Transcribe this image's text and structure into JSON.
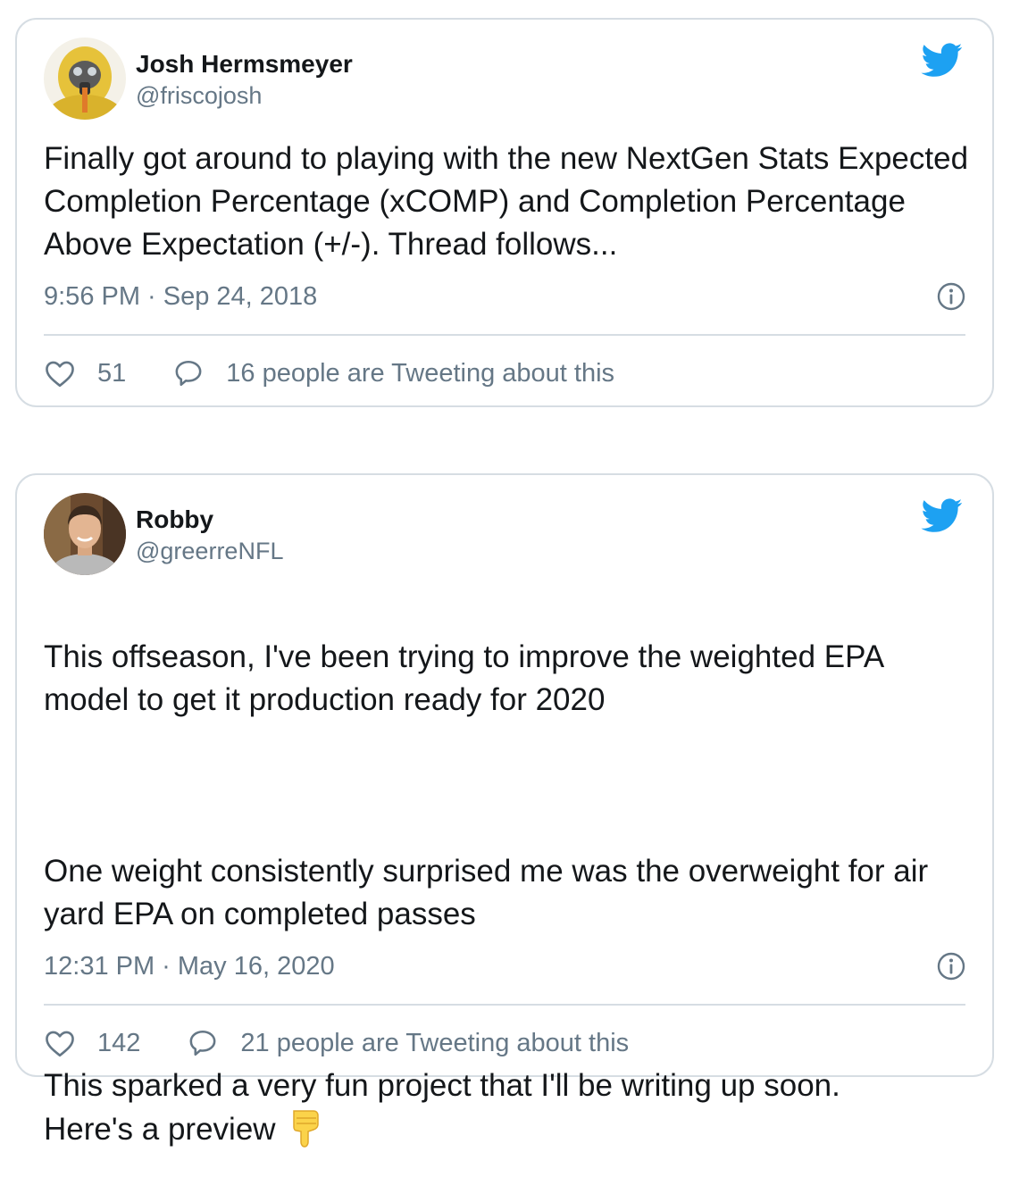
{
  "tweets": [
    {
      "author_name": "Josh Hermsmeyer",
      "author_handle": "@friscojosh",
      "avatar_icon": "hazmat-avatar",
      "text": "Finally got around to playing with the new NextGen Stats Expected Completion Percentage (xCOMP) and Completion Percentage Above Expectation (+/-). Thread follows...",
      "timestamp": "9:56 PM · Sep 24, 2018",
      "likes": "51",
      "tweeting_text": "16 people are Tweeting about this"
    },
    {
      "author_name": "Robby",
      "author_handle": "@greerreNFL",
      "avatar_icon": "profile-photo-avatar",
      "text_lines": [
        "This offseason, I've been trying to improve the weighted EPA model to get it production ready for 2020",
        "One weight consistently surprised me was the overweight for air yard EPA on completed passes",
        "This sparked a very fun project that I'll be writing up soon.\nHere's a preview"
      ],
      "emoji_icon": "backhand-index-pointing-down-emoji",
      "timestamp": "12:31 PM · May 16, 2020",
      "likes": "142",
      "tweeting_text": "21 people are Tweeting about this"
    }
  ],
  "colors": {
    "twitter_blue": "#1da1f2",
    "text_primary": "#14171a",
    "text_secondary": "#657786",
    "border": "#d6dde3"
  }
}
